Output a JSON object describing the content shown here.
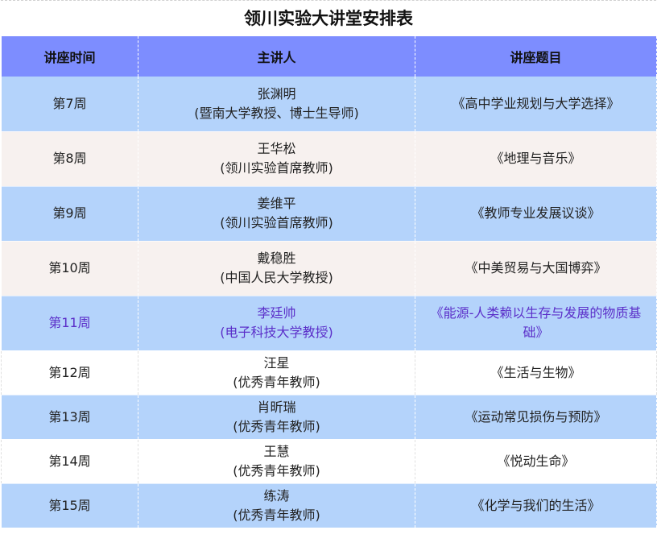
{
  "title": "领川实验大讲堂安排表",
  "headers": [
    "讲座时间",
    "主讲人",
    "讲座题目"
  ],
  "rows": [
    {
      "week": "第7周",
      "name": "张渊明",
      "affiliation": "(暨南大学教授、博士生导师)",
      "topic": "《高中学业规划与大学选择》"
    },
    {
      "week": "第8周",
      "name": "王华松",
      "affiliation": "(领川实验首席教师)",
      "topic": "《地理与音乐》"
    },
    {
      "week": "第9周",
      "name": "姜维平",
      "affiliation": "(领川实验首席教师)",
      "topic": "《教师专业发展议谈》"
    },
    {
      "week": "第10周",
      "name": "戴稳胜",
      "affiliation": "(中国人民大学教授)",
      "topic": "《中美贸易与大国博弈》"
    },
    {
      "week": "第11周",
      "name": "李廷帅",
      "affiliation": "(电子科技大学教授)",
      "topic": "《能源-人类赖以生存与发展的物质基础》"
    },
    {
      "week": "第12周",
      "name": "汪星",
      "affiliation": "(优秀青年教师)",
      "topic": "《生活与生物》"
    },
    {
      "week": "第13周",
      "name": "肖昕瑞",
      "affiliation": "(优秀青年教师)",
      "topic": "《运动常见损伤与预防》"
    },
    {
      "week": "第14周",
      "name": "王慧",
      "affiliation": "(优秀青年教师)",
      "topic": "《悦动生命》"
    },
    {
      "week": "第15周",
      "name": "练涛",
      "affiliation": "(优秀青年教师)",
      "topic": "《化学与我们的生活》"
    }
  ],
  "colors": {
    "header_bg": "#7d8dff",
    "row_blue": "#b4d3fb",
    "row_cream": "#f7f1ef",
    "row_white": "#ffffff",
    "highlight_text": "#5b2fc9"
  }
}
